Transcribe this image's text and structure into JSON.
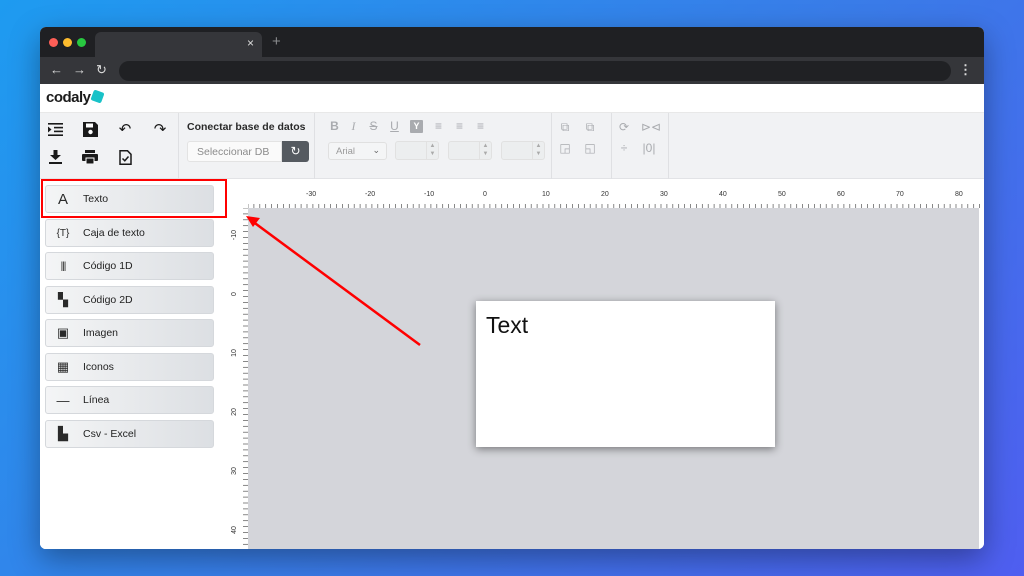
{
  "browser": {
    "tab_close_glyph": "×",
    "new_tab_glyph": "+",
    "back_glyph": "←",
    "forward_glyph": "→",
    "reload_glyph": "↻",
    "menu_glyph": "⋮"
  },
  "app": {
    "logo_text": "codaly",
    "accent_color": "#19c2c8"
  },
  "toolbar": {
    "connect_label": "Conectar base de datos",
    "db_placeholder": "Seleccionar DB",
    "font_value": "Arial",
    "file_icons": [
      "indent-icon",
      "save-icon",
      "undo-icon",
      "redo-icon",
      "download-icon",
      "print-icon",
      "check-document-icon"
    ],
    "format_glyphs": {
      "bold": "B",
      "italic": "I",
      "strike": "S",
      "underline": "U",
      "color": "Y",
      "align_left": "≡",
      "align_center": "≡",
      "align_right": "≡"
    }
  },
  "sidebar": {
    "items": [
      {
        "label": "Texto",
        "icon": "A"
      },
      {
        "label": "Caja de texto",
        "icon": "{T}"
      },
      {
        "label": "Código 1D",
        "icon": "|||"
      },
      {
        "label": "Código 2D",
        "icon": "▚"
      },
      {
        "label": "Imagen",
        "icon": "▣"
      },
      {
        "label": "Iconos",
        "icon": "▦"
      },
      {
        "label": "Línea",
        "icon": "—"
      },
      {
        "label": "Csv - Excel",
        "icon": "▙"
      }
    ],
    "highlight_color": "#ff0000"
  },
  "rulers": {
    "horizontal_labels": [
      "-30",
      "-20",
      "-10",
      "0",
      "10",
      "20",
      "30",
      "40",
      "50",
      "60",
      "70",
      "80"
    ],
    "vertical_labels": [
      "-10",
      "0",
      "10",
      "20",
      "30",
      "40"
    ]
  },
  "canvas": {
    "label_text": "Text",
    "background_color": "#d4d5da"
  },
  "annotation": {
    "arrow_color": "#ff0000"
  }
}
